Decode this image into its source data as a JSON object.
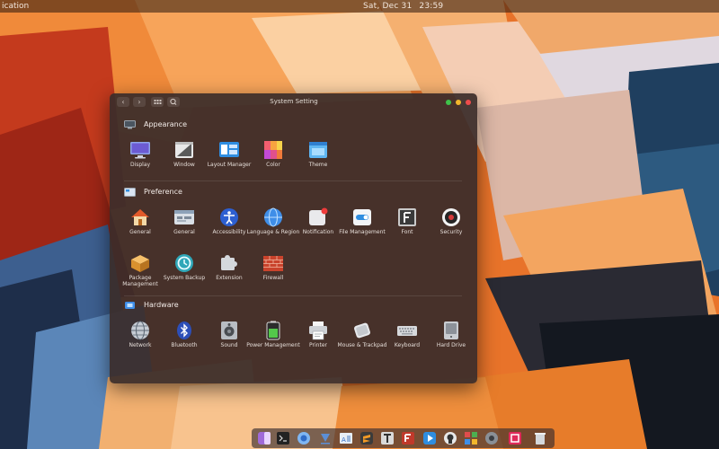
{
  "top_panel": {
    "active_app": "ication",
    "date": "Sat, Dec 31",
    "time": "23:59"
  },
  "window": {
    "title": "System Setting",
    "nav": {
      "back_glyph": "‹",
      "forward_glyph": "›",
      "grid_glyph": "⋮⋮",
      "search_glyph": "⌕"
    }
  },
  "sections": {
    "appearance": {
      "title": "Appearance",
      "icon": "monitor-icon",
      "items": [
        {
          "label": "Display",
          "icon": "display-icon"
        },
        {
          "label": "Window",
          "icon": "window-icon"
        },
        {
          "label": "Layout Manager",
          "icon": "layout-manager-icon"
        },
        {
          "label": "Color",
          "icon": "color-palette-icon"
        },
        {
          "label": "Theme",
          "icon": "theme-icon"
        }
      ]
    },
    "preference": {
      "title": "Preference",
      "icon": "preference-icon",
      "items": [
        {
          "label": "General",
          "icon": "home-icon"
        },
        {
          "label": "General",
          "icon": "general-panel-icon"
        },
        {
          "label": "Accessibility",
          "icon": "accessibility-icon"
        },
        {
          "label": "Language & Region",
          "icon": "language-globe-icon"
        },
        {
          "label": "Notification",
          "icon": "notification-icon"
        },
        {
          "label": "File Management",
          "icon": "file-management-icon"
        },
        {
          "label": "Font",
          "icon": "font-icon"
        },
        {
          "label": "Security",
          "icon": "security-icon"
        },
        {
          "label": "Package Management",
          "icon": "package-icon"
        },
        {
          "label": "System Backup",
          "icon": "backup-icon"
        },
        {
          "label": "Extension",
          "icon": "extension-puzzle-icon"
        },
        {
          "label": "Firewall",
          "icon": "firewall-icon"
        }
      ]
    },
    "hardware": {
      "title": "Hardware",
      "icon": "hardware-icon",
      "items": [
        {
          "label": "Network",
          "icon": "network-globe-icon"
        },
        {
          "label": "Bluetooth",
          "icon": "bluetooth-icon"
        },
        {
          "label": "Sound",
          "icon": "speaker-icon"
        },
        {
          "label": "Power Management",
          "icon": "battery-icon"
        },
        {
          "label": "Printer",
          "icon": "printer-icon"
        },
        {
          "label": "Mouse & Trackpad",
          "icon": "mouse-icon"
        },
        {
          "label": "Keyboard",
          "icon": "keyboard-icon"
        },
        {
          "label": "Hard Drive",
          "icon": "hard-drive-icon"
        }
      ]
    }
  },
  "dock": {
    "items": [
      "finder-icon",
      "terminal-icon",
      "browser-icon",
      "downloads-icon",
      "document-viewer-icon",
      "sublime-text-icon",
      "typora-icon",
      "filezilla-icon",
      "media-player-icon",
      "github-icon",
      "app-grid-icon",
      "settings-icon",
      "screenshot-icon",
      "trash-icon"
    ]
  },
  "colors": {
    "accent_orange": "#e8742a",
    "traffic_green": "#3fc24a",
    "traffic_yellow": "#f2b62c",
    "traffic_red": "#ee4c4c"
  }
}
